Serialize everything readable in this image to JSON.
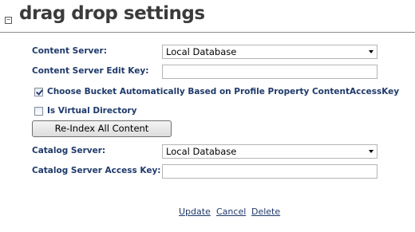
{
  "header": {
    "title": "drag drop settings",
    "collapse_glyph": "−"
  },
  "form": {
    "content_server": {
      "label": "Content Server:",
      "value": "Local Database"
    },
    "content_server_edit_key": {
      "label": "Content Server Edit Key:",
      "value": ""
    },
    "choose_bucket": {
      "label": "Choose Bucket Automatically Based on Profile Property ContentAccessKey",
      "checked": true
    },
    "virtual_directory": {
      "label": "Is Virtual Directory",
      "checked": false
    },
    "reindex_button": "Re-Index All Content",
    "catalog_server": {
      "label": "Catalog Server:",
      "value": "Local Database"
    },
    "catalog_server_access_key": {
      "label": "Catalog Server Access Key:",
      "value": ""
    }
  },
  "actions": {
    "update": "Update",
    "cancel": "Cancel",
    "delete": "Delete"
  },
  "colors": {
    "label": "#1f3a6b",
    "title": "#3b3b3b",
    "rule": "#8c8c8c"
  }
}
